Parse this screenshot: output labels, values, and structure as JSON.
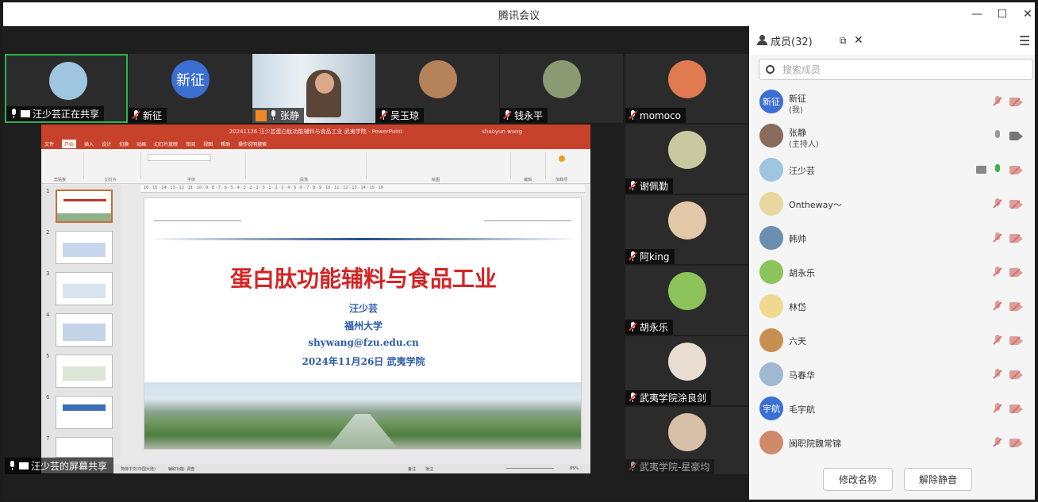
{
  "window": {
    "title": "腾讯会议",
    "min": "—",
    "max": "☐",
    "close": "✕"
  },
  "strip": [
    {
      "name": "汪少芸正在共享",
      "mic": "on",
      "screen": true,
      "color": "#9ec6e0"
    },
    {
      "name": "新征",
      "mic": "off",
      "avatar_text": "新征",
      "color": "#3b6fd1"
    },
    {
      "name": "张静",
      "mic": "on",
      "color": "#8fa6b8"
    },
    {
      "name": "吴玉琼",
      "mic": "off",
      "color": "#b5825a"
    },
    {
      "name": "钱永平",
      "mic": "off",
      "color": "#8a9a72"
    },
    {
      "name": "momoco",
      "mic": "off",
      "color": "#e07a50"
    }
  ],
  "side": [
    {
      "name": "谢佩勤",
      "mic": "off",
      "color": "#c9c9a0"
    },
    {
      "name": "阿king",
      "mic": "off",
      "color": "#e3c8a8"
    },
    {
      "name": "胡永乐",
      "mic": "off",
      "color": "#8cc35a"
    },
    {
      "name": "武夷学院涂良剑",
      "mic": "off",
      "color": "#e8ddd0"
    },
    {
      "name": "武夷学院-星豪均",
      "mic": "off",
      "color": "#d8c0a8"
    }
  ],
  "share_tag": {
    "label": "汪少芸的屏幕共享"
  },
  "ppt": {
    "title": "20241126 汪少芸蛋白肽功能辅料与食品工业 武夷学院 - PowerPoint",
    "user": "shaoyun wang",
    "tabs": [
      "文件",
      "开始",
      "插入",
      "设计",
      "切换",
      "动画",
      "幻灯片放映",
      "审阅",
      "视图",
      "帮助",
      "操作说明搜索"
    ],
    "ribbon_groups": [
      "剪贴板",
      "幻灯片",
      "字体",
      "段落",
      "绘图",
      "编辑",
      "加载项"
    ],
    "ruler": "16 · 15 · 14 · 13 · 12 · 11 · 10 · 9 · 8 · 7 · 6 · 5 · 4 · 3 · 2 · 1 · 0 · 1 · 2 · 3 · 4 · 5 · 6 · 7 · 8 · 9 · 10 · 11 · 12 · 13 · 14 · 15 · 16",
    "thumb_numbers": [
      "1",
      "2",
      "3",
      "4",
      "5",
      "6",
      "7"
    ],
    "status_left": "简体中文(中国大陆)",
    "status_access": "辅助功能: 调查",
    "status_notes": "备注",
    "status_comments": "批注",
    "zoom": "85%"
  },
  "slide": {
    "title": "蛋白肽功能辅料与食品工业",
    "author": "汪少芸",
    "org": "福州大学",
    "email": "shywang@fzu.edu.cn",
    "date_place": "2024年11月26日  武夷学院"
  },
  "panel": {
    "header": "成员(32)",
    "search_placeholder": "搜索成员",
    "members": [
      {
        "name": "新征",
        "sub": "(我)",
        "avatar_text": "新征",
        "color": "#3b6fd1",
        "mic": "muted",
        "cam": "off"
      },
      {
        "name": "张静",
        "sub": "(主持人)",
        "color": "#8a6a5a",
        "mic": "gray",
        "cam": "gray"
      },
      {
        "name": "汪少芸",
        "color": "#9ec6e0",
        "mic": "green",
        "cam": "off",
        "sharing": true
      },
      {
        "name": "Ontheway～",
        "color": "#e8d8a0",
        "mic": "muted",
        "cam": "off"
      },
      {
        "name": "韩帅",
        "color": "#6a8fb0",
        "mic": "muted",
        "cam": "off"
      },
      {
        "name": "胡永乐",
        "color": "#8cc35a",
        "mic": "muted",
        "cam": "off"
      },
      {
        "name": "林岱",
        "color": "#f0d890",
        "mic": "muted",
        "cam": "off"
      },
      {
        "name": "六天",
        "color": "#c89050",
        "mic": "muted",
        "cam": "off"
      },
      {
        "name": "马春华",
        "color": "#a0b8d0",
        "mic": "muted",
        "cam": "off"
      },
      {
        "name": "毛宇航",
        "avatar_text": "宇航",
        "color": "#3b6fd1",
        "mic": "muted",
        "cam": "off"
      },
      {
        "name": "闽职院魏常锦",
        "color": "#d08a6a",
        "mic": "muted",
        "cam": "off"
      }
    ],
    "rename_button": "修改名称",
    "unmute_button": "解除静音"
  }
}
